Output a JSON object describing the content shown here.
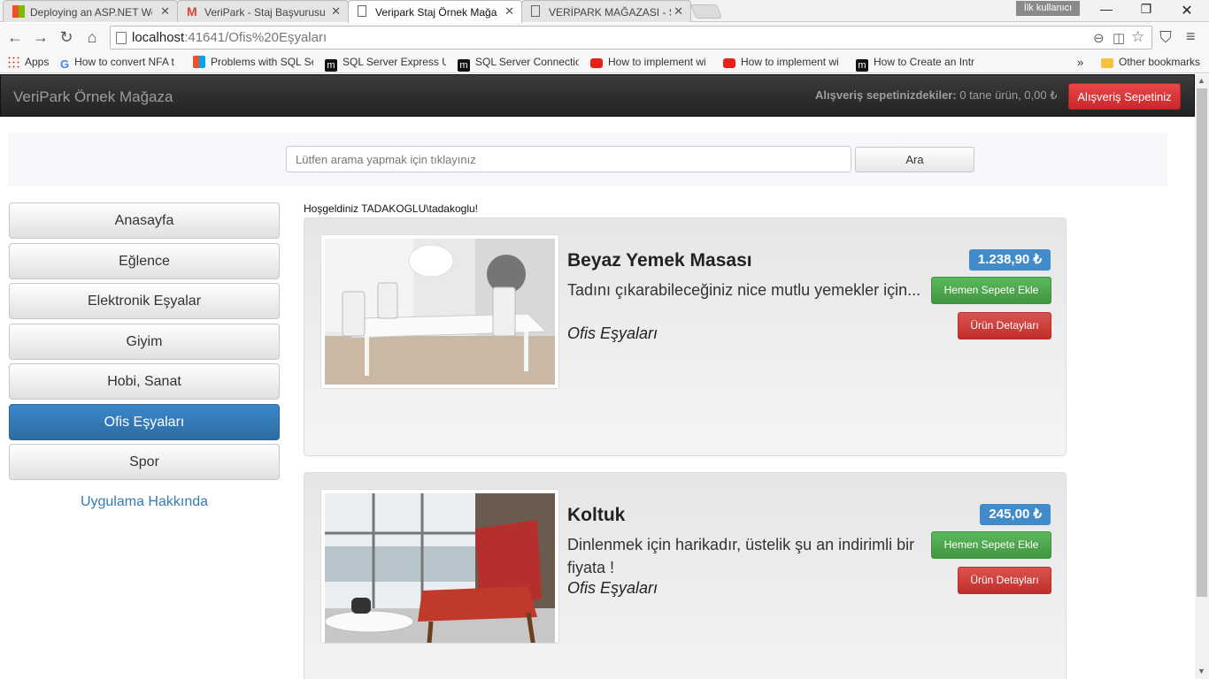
{
  "browser": {
    "tabs": [
      {
        "title": "Deploying an ASP.NET We",
        "icon": "windows-icon"
      },
      {
        "title": "VeriPark - Staj Başvurusu",
        "icon": "gmail-icon"
      },
      {
        "title": "Veripark Staj Örnek Mağaz",
        "icon": "page-icon"
      },
      {
        "title": "VERİPARK MAĞAZASI - SE",
        "icon": "page-icon"
      }
    ],
    "profile": "İlk kullanıcı",
    "url_host": "localhost",
    "url_path": ":41641/Ofis%20Eşyaları",
    "bookmarks": [
      {
        "label": "Apps",
        "icon": "apps-icon"
      },
      {
        "label": "How to convert NFA t",
        "icon": "google-icon"
      },
      {
        "label": "Problems with SQL Se",
        "icon": "windows-icon"
      },
      {
        "label": "SQL Server Express Us",
        "icon": "m-icon"
      },
      {
        "label": "SQL Server Connectio",
        "icon": "m-icon"
      },
      {
        "label": "How to implement wi",
        "icon": "youtube-icon"
      },
      {
        "label": "How to implement wi",
        "icon": "youtube-icon"
      },
      {
        "label": "How to Create an Intr",
        "icon": "m-icon"
      },
      {
        "label": "Other bookmarks",
        "icon": "folder-icon"
      }
    ]
  },
  "site": {
    "brand": "VeriPark Örnek Mağaza",
    "cart_label": "Alışveriş sepetinizdekiler:",
    "cart_summary": "0 tane ürün, 0,00 ₺",
    "cart_button": "Alışveriş Sepetiniz",
    "search_placeholder": "Lütfen arama yapmak için tıklayınız",
    "search_button": "Ara",
    "welcome": "Hoşgeldiniz TADAKOGLU\\tadakoglu!",
    "categories": [
      "Anasayfa",
      "Eğlence",
      "Elektronik Eşyalar",
      "Giyim",
      "Hobi, Sanat",
      "Ofis Eşyaları",
      "Spor"
    ],
    "active_category": "Ofis Eşyaları",
    "about_link": "Uygulama Hakkında"
  },
  "products": [
    {
      "name": "Beyaz Yemek Masası",
      "description": "Tadını çıkarabileceğiniz nice mutlu yemekler için...",
      "category": "Ofis Eşyaları",
      "price": "1.238,90 ₺",
      "add_label": "Hemen Sepete Ekle",
      "detail_label": "Ürün Detayları"
    },
    {
      "name": "Koltuk",
      "description": "Dinlenmek için harikadır, üstelik şu an indirimli bir fiyata !",
      "category": "Ofis Eşyaları",
      "price": "245,00 ₺",
      "add_label": "Hemen Sepete Ekle",
      "detail_label": "Ürün Detayları"
    }
  ],
  "colors": {
    "accent_blue": "#337ab7",
    "danger_red": "#d9534f",
    "success_green": "#5cb85c"
  }
}
